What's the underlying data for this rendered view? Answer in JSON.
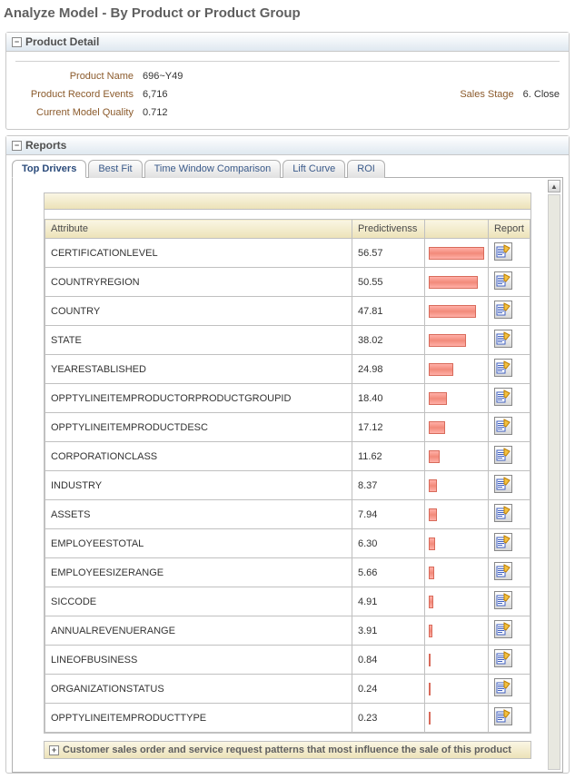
{
  "page_title": "Analyze Model - By Product or Product Group",
  "product_detail": {
    "panel_title": "Product Detail",
    "labels": {
      "product_name": "Product Name",
      "record_events": "Product Record Events",
      "model_quality": "Current Model Quality",
      "sales_stage": "Sales Stage"
    },
    "values": {
      "product_name": "696~Y49",
      "record_events": "6,716",
      "model_quality": "0.712",
      "sales_stage": "6. Close"
    }
  },
  "reports": {
    "panel_title": "Reports",
    "tabs": [
      "Top Drivers",
      "Best Fit",
      "Time Window Comparison",
      "Lift Curve",
      "ROI"
    ],
    "active_tab": 0,
    "columns": {
      "attribute": "Attribute",
      "predictiveness": "Predictivenss",
      "bar": "",
      "report": "Report"
    },
    "max_value": 56.57,
    "rows": [
      {
        "attr": "CERTIFICATIONLEVEL",
        "val": 56.57
      },
      {
        "attr": "COUNTRYREGION",
        "val": 50.55
      },
      {
        "attr": "COUNTRY",
        "val": 47.81
      },
      {
        "attr": "STATE",
        "val": 38.02
      },
      {
        "attr": "YEARESTABLISHED",
        "val": 24.98
      },
      {
        "attr": "OPPTYLINEITEMPRODUCTORPRODUCTGROUPID",
        "val": 18.4
      },
      {
        "attr": "OPPTYLINEITEMPRODUCTDESC",
        "val": 17.12
      },
      {
        "attr": "CORPORATIONCLASS",
        "val": 11.62
      },
      {
        "attr": "INDUSTRY",
        "val": 8.37
      },
      {
        "attr": "ASSETS",
        "val": 7.94
      },
      {
        "attr": "EMPLOYEESTOTAL",
        "val": 6.3
      },
      {
        "attr": "EMPLOYEESIZERANGE",
        "val": 5.66
      },
      {
        "attr": "SICCODE",
        "val": 4.91
      },
      {
        "attr": "ANNUALREVENUERANGE",
        "val": 3.91
      },
      {
        "attr": "LINEOFBUSINESS",
        "val": 0.84
      },
      {
        "attr": "ORGANIZATIONSTATUS",
        "val": 0.24
      },
      {
        "attr": "OPPTYLINEITEMPRODUCTTYPE",
        "val": 0.23
      }
    ],
    "footer_text": "Customer sales order and service request patterns that most influence the sale of this product"
  }
}
